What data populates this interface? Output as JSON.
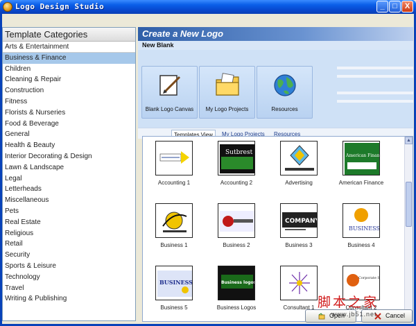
{
  "window": {
    "title": "Logo Design Studio"
  },
  "titlebar": {
    "minimize": "_",
    "maximize": "□",
    "close": "X"
  },
  "categories": {
    "header": "Template Categories",
    "items": [
      "Arts & Entertainment",
      "Business & Finance",
      "Children",
      "Cleaning & Repair",
      "Construction",
      "Fitness",
      "Florists & Nurseries",
      "Food & Beverage",
      "General",
      "Health & Beauty",
      "Interior Decorating & Design",
      "Lawn & Landscape",
      "Legal",
      "Letterheads",
      "Miscellaneous",
      "Pets",
      "Real Estate",
      "Religious",
      "Retail",
      "Security",
      "Sports & Leisure",
      "Technology",
      "Travel",
      "Writing & Publishing"
    ],
    "selected": "Business & Finance"
  },
  "create": {
    "title": "Create a New Logo",
    "new_blank": "New Blank",
    "actions": [
      {
        "label": "Blank Logo Canvas",
        "icon": "blank-canvas-icon"
      },
      {
        "label": "My Logo Projects",
        "icon": "folder-icon"
      },
      {
        "label": "Resources",
        "icon": "globe-icon"
      }
    ]
  },
  "tabs": [
    "Templates View",
    "My Logo Projects",
    "Resources"
  ],
  "templates": [
    {
      "label": "Accounting 1",
      "thumb_text": ""
    },
    {
      "label": "Accounting 2",
      "thumb_text": "Sutbrest"
    },
    {
      "label": "Advertising",
      "thumb_text": ""
    },
    {
      "label": "American Finance",
      "thumb_text": "American Financial"
    },
    {
      "label": "Business 1",
      "thumb_text": ""
    },
    {
      "label": "Business 2",
      "thumb_text": ""
    },
    {
      "label": "Business 3",
      "thumb_text": "COMPANY"
    },
    {
      "label": "Business 4",
      "thumb_text": "BUSINESS"
    },
    {
      "label": "Business 5",
      "thumb_text": "BUSINESS"
    },
    {
      "label": "Business Logos",
      "thumb_text": "Business logos"
    },
    {
      "label": "Consultant 1",
      "thumb_text": ""
    },
    {
      "label": "Consultant 2",
      "thumb_text": "Corporate Specialists"
    }
  ],
  "buttons": {
    "open": "Open",
    "cancel": "Cancel"
  },
  "watermark": {
    "text": "脚本之家",
    "url": "www.jb51.net"
  },
  "colors": {
    "title_bar": "#0a5ee8",
    "selection": "#a6c8ea",
    "header_blue": "#2f5fa8",
    "watermark": "#d01818"
  }
}
